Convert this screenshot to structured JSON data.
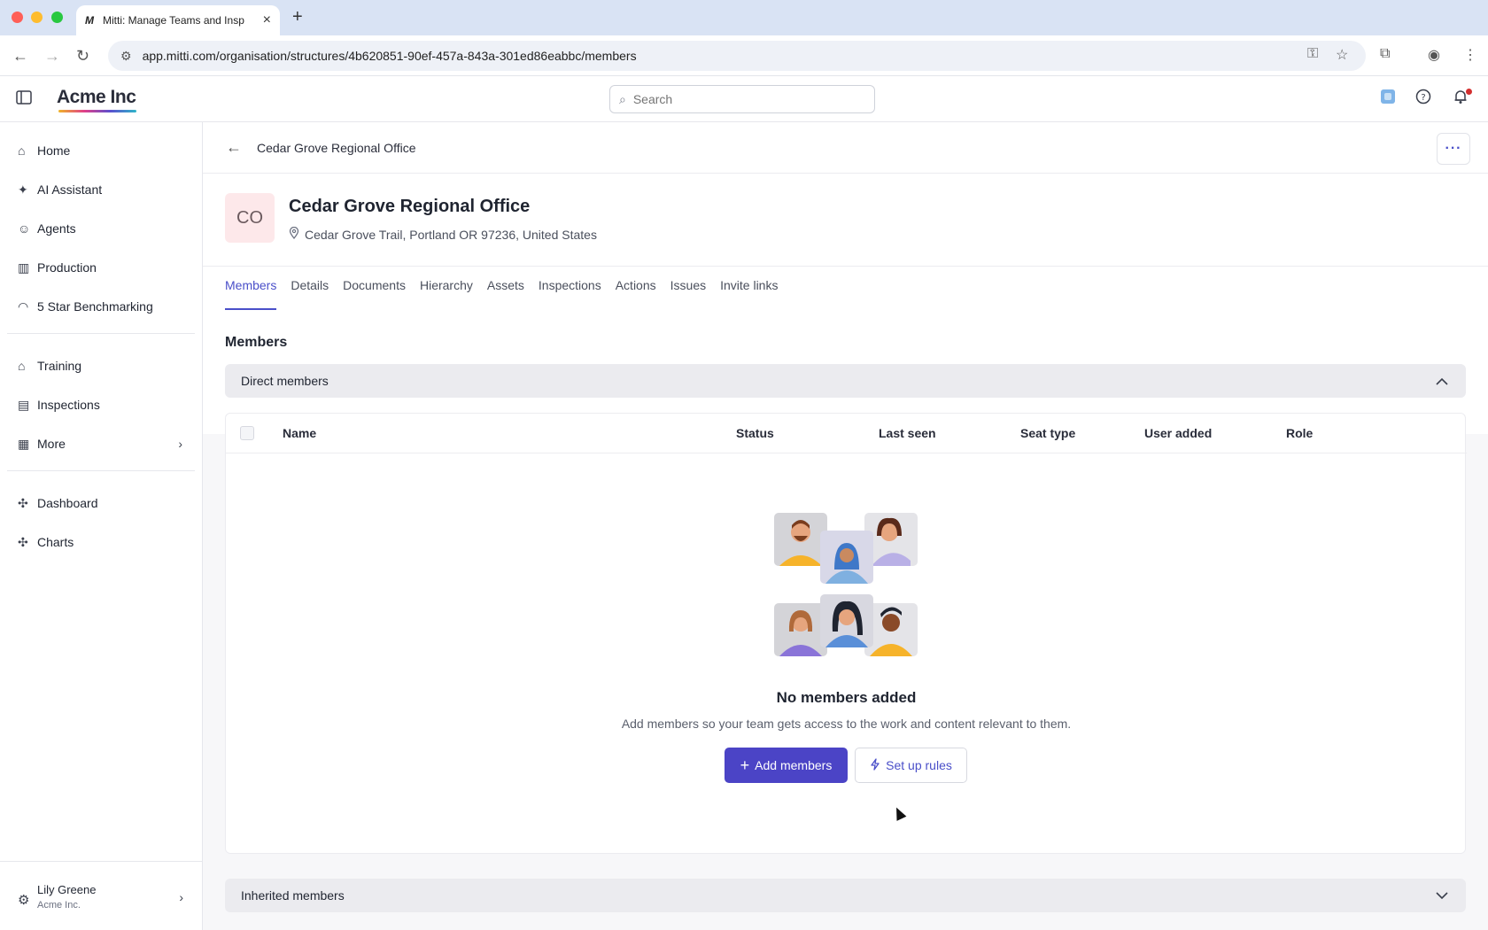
{
  "browser": {
    "tab_title": "Mitti: Manage Teams and Insp",
    "tab_favicon": "M",
    "new_tab": "+",
    "url": "app.mitti.com/organisation/structures/4b620851-90ef-457a-843a-301ed86eabbc/members",
    "traffic_colors": [
      "#ff5f57",
      "#febc2e",
      "#28c840"
    ]
  },
  "header": {
    "brand": "Acme Inc",
    "search_placeholder": "Search"
  },
  "sidebar": {
    "items": [
      {
        "label": "Home",
        "icon": "home-icon"
      },
      {
        "label": "AI Assistant",
        "icon": "sparkle-icon"
      },
      {
        "label": "Agents",
        "icon": "robot-icon"
      },
      {
        "label": "Production",
        "icon": "building-icon"
      },
      {
        "label": "5 Star Benchmarking",
        "icon": "gauge-icon"
      },
      {
        "label": "Training",
        "icon": "graduation-cap-icon"
      },
      {
        "label": "Inspections",
        "icon": "clipboard-icon"
      },
      {
        "label": "More",
        "icon": "grid-icon"
      },
      {
        "label": "Dashboard",
        "icon": "puzzle-icon"
      },
      {
        "label": "Charts",
        "icon": "puzzle-icon"
      }
    ],
    "user": {
      "name": "Lily Greene",
      "org": "Acme Inc."
    }
  },
  "page": {
    "breadcrumb_title": "Cedar Grove Regional Office",
    "avatar_initials": "CO",
    "title": "Cedar Grove Regional Office",
    "address": "Cedar Grove Trail, Portland OR 97236, United States",
    "tabs": [
      "Members",
      "Details",
      "Documents",
      "Hierarchy",
      "Assets",
      "Inspections",
      "Actions",
      "Issues",
      "Invite links"
    ],
    "active_tab": "Members",
    "section_title": "Members",
    "direct_members_label": "Direct members",
    "inherited_members_label": "Inherited members",
    "columns": [
      "Name",
      "Status",
      "Last seen",
      "Seat type",
      "User added",
      "Role"
    ],
    "empty_title": "No members added",
    "empty_subtitle": "Add members so your team gets access to the work and content relevant to them.",
    "add_members_label": "Add members",
    "setup_rules_label": "Set up rules"
  },
  "colors": {
    "accent": "#4b44c6",
    "avatar_bg": "#fde8ea"
  }
}
